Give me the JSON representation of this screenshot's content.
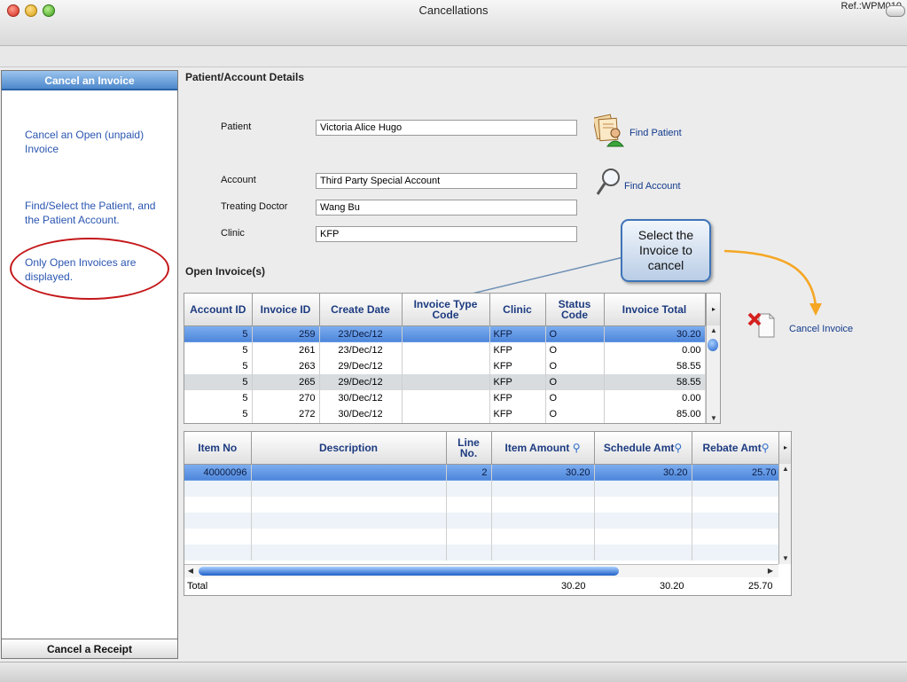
{
  "window": {
    "title": "Cancellations",
    "ref": "Ref.:WPM010"
  },
  "sidebar": {
    "header": "Cancel an Invoice",
    "notes": [
      "Cancel an Open (unpaid) Invoice",
      "Find/Select the Patient, and the Patient Account.",
      "Only Open Invoices are displayed."
    ],
    "footer": "Cancel a Receipt"
  },
  "details": {
    "section_title": "Patient/Account Details",
    "patient_label": "Patient",
    "patient_value": "Victoria Alice Hugo",
    "find_patient": "Find Patient",
    "account_label": "Account",
    "account_value": "Third Party Special Account",
    "find_account": "Find Account",
    "doctor_label": "Treating Doctor",
    "doctor_value": "Wang Bu",
    "clinic_label": "Clinic",
    "clinic_value": "KFP"
  },
  "callout": {
    "text": "Select the Invoice to cancel"
  },
  "invoices": {
    "section_title": "Open Invoice(s)",
    "columns": [
      "Account ID",
      "Invoice ID",
      "Create Date",
      "Invoice Type Code",
      "Clinic",
      "Status Code",
      "Invoice Total"
    ],
    "rows": [
      [
        "5",
        "259",
        "23/Dec/12",
        "",
        "KFP",
        "O",
        "30.20"
      ],
      [
        "5",
        "261",
        "23/Dec/12",
        "",
        "KFP",
        "O",
        "0.00"
      ],
      [
        "5",
        "263",
        "29/Dec/12",
        "",
        "KFP",
        "O",
        "58.55"
      ],
      [
        "5",
        "265",
        "29/Dec/12",
        "",
        "KFP",
        "O",
        "58.55"
      ],
      [
        "5",
        "270",
        "30/Dec/12",
        "",
        "KFP",
        "O",
        "0.00"
      ],
      [
        "5",
        "272",
        "30/Dec/12",
        "",
        "KFP",
        "O",
        "85.00"
      ]
    ],
    "cancel_label": "Cancel Invoice"
  },
  "items": {
    "columns": [
      "Item No",
      "Description",
      "Line No.",
      "Item Amount",
      "Schedule Amt",
      "Rebate Amt"
    ],
    "rows": [
      [
        "40000096",
        "",
        "2",
        "30.20",
        "30.20",
        "25.70"
      ]
    ],
    "total_label": "Total",
    "totals": [
      "30.20",
      "30.20",
      "25.70"
    ]
  },
  "colors": {
    "accent": "#4d86da",
    "annotation_red": "#c4171a",
    "arrow_orange": "#f5a623"
  }
}
